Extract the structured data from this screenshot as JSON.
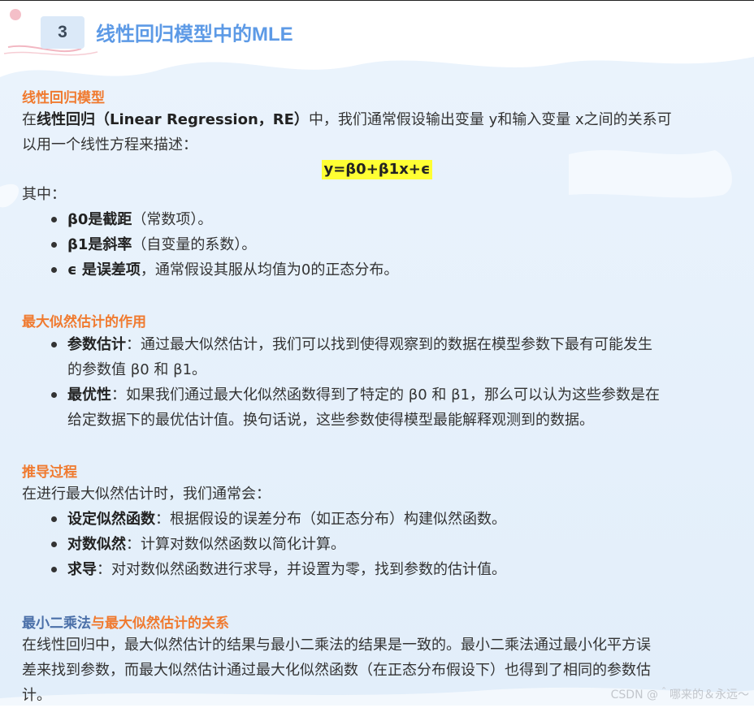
{
  "header": {
    "number": "3",
    "title": "线性回归模型中的MLE"
  },
  "section1": {
    "title": "线性回归模型",
    "intro_pre": "在",
    "intro_bold": "线性回归（Linear Regression，RE）",
    "intro_rest": "中，我们通常假设输出变量 y和输入变量 x之间的关系可",
    "intro_line2": "以用一个线性方程来描述：",
    "formula": "y=β0+β1x+ϵ",
    "where": "其中：",
    "items": [
      {
        "bold": "β0是截距",
        "text": "（常数项）。"
      },
      {
        "bold": "β1是斜率",
        "text": "（自变量的系数）。"
      },
      {
        "bold": "ϵ 是误差项",
        "text": "，通常假设其服从均值为0的正态分布。"
      }
    ]
  },
  "section2": {
    "title": "最大似然估计的作用",
    "items": [
      {
        "bold": "参数估计",
        "text": "：通过最大似然估计，我们可以找到使得观察到的数据在模型参数下最有可能发生",
        "text2": "的参数值 β0 和 β1。"
      },
      {
        "bold": "最优性",
        "text": "：如果我们通过最大化似然函数得到了特定的 β0 和 β1，那么可以认为这些参数是在",
        "text2": "给定数据下的最优估计值。换句话说，这些参数使得模型最能解释观测到的数据。"
      }
    ]
  },
  "section3": {
    "title": "推导过程",
    "intro": "在进行最大似然估计时，我们通常会：",
    "items": [
      {
        "bold": "设定似然函数",
        "text": "：根据假设的误差分布（如正态分布）构建似然函数。"
      },
      {
        "bold": "对数似然",
        "text": "：计算对数似然函数以简化计算。"
      },
      {
        "bold": "求导",
        "text": "：对对数似然函数进行求导，并设置为零，找到参数的估计值。"
      }
    ]
  },
  "section4": {
    "title_part1": "最小二乘法",
    "title_part2": "与最大似然估计的关系",
    "line1": "在线性回归中，最大似然估计的结果与最小二乘法的结果是一致的。最小二乘法通过最小化平方误",
    "line2": "差来找到参数，而最大似然估计通过最大化似然函数（在正态分布假设下）也得到了相同的参数估",
    "line3": "计。"
  },
  "watermark": "CSDN @＾哪来的＆永远～",
  "colors": {
    "accent_orange": "#f07a2f",
    "accent_blue": "#5d9ae6",
    "formula_highlight": "#ffff33",
    "background_wash": "#e6f1fb"
  }
}
